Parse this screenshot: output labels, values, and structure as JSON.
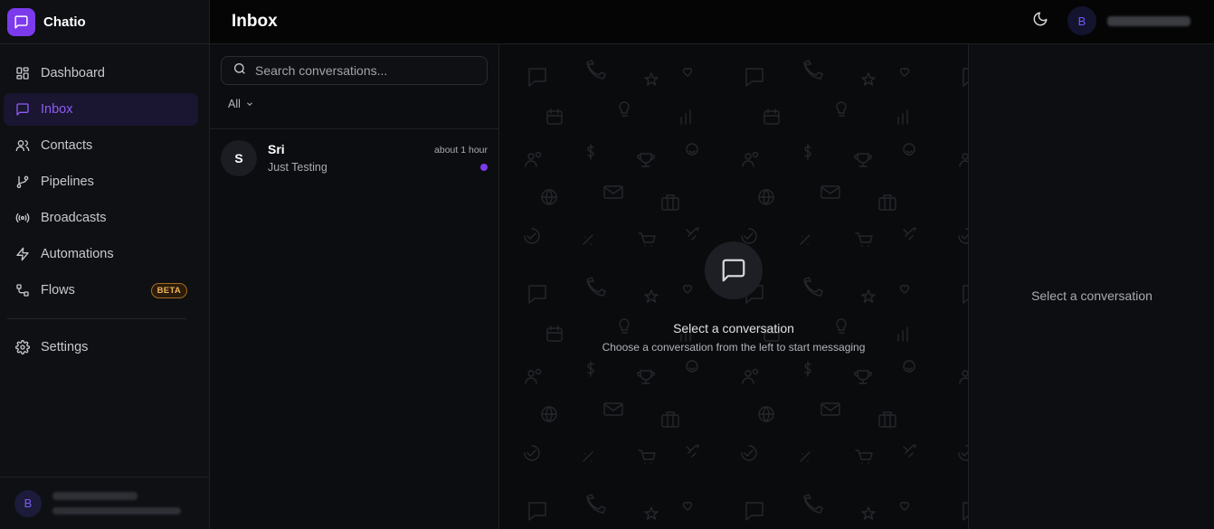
{
  "app": {
    "name": "Chatio",
    "accent": "#7c3aed"
  },
  "sidebar": {
    "items": [
      {
        "label": "Dashboard",
        "icon": "dashboard-icon"
      },
      {
        "label": "Inbox",
        "icon": "message-icon",
        "active": true
      },
      {
        "label": "Contacts",
        "icon": "users-icon"
      },
      {
        "label": "Pipelines",
        "icon": "git-branch-icon"
      },
      {
        "label": "Broadcasts",
        "icon": "broadcast-icon"
      },
      {
        "label": "Automations",
        "icon": "zap-icon"
      },
      {
        "label": "Flows",
        "icon": "flow-icon",
        "badge": "BETA"
      }
    ],
    "settings_label": "Settings",
    "user": {
      "initial": "B"
    }
  },
  "header": {
    "title": "Inbox",
    "avatar_initial": "B"
  },
  "conversations": {
    "search_placeholder": "Search conversations...",
    "filter_label": "All",
    "items": [
      {
        "initial": "S",
        "name": "Sri",
        "preview": "Just Testing",
        "time": "about 1 hour",
        "unread": true
      }
    ]
  },
  "chat": {
    "empty_title": "Select a conversation",
    "empty_subtitle": "Choose a conversation from the left to start messaging"
  },
  "details": {
    "empty_text": "Select a conversation"
  }
}
